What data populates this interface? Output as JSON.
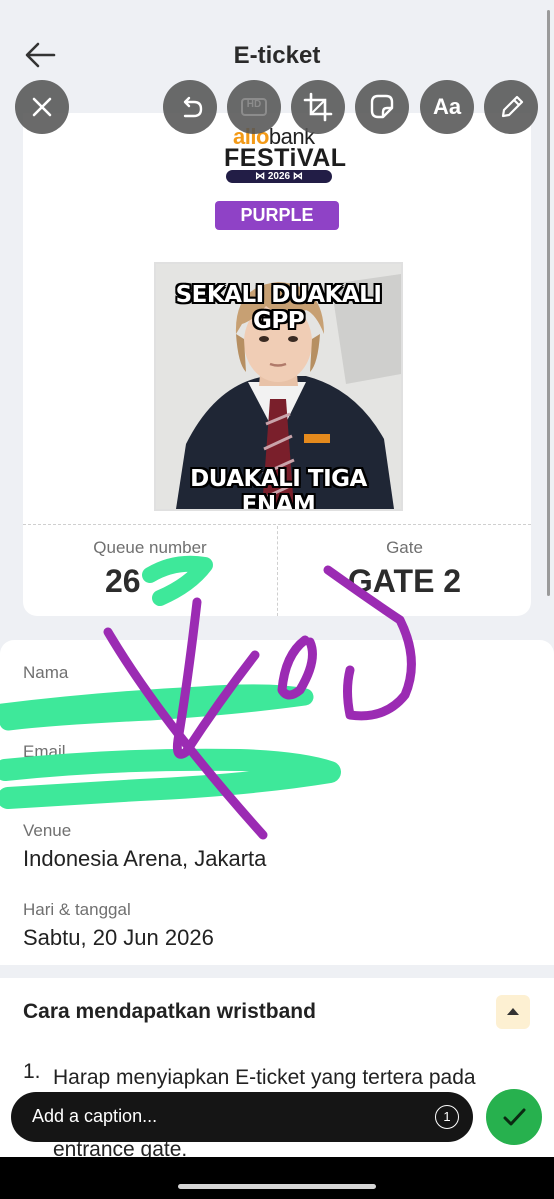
{
  "header": {
    "title": "E-ticket"
  },
  "ticket": {
    "logo_word1": "allo",
    "logo_word2": "bank",
    "logo_festival": "FESTiVAL",
    "logo_year": "⋈ 2026 ⋈",
    "tier_badge": "PURPLE",
    "meme_top_text": "SEKALI DUAKALI GPP",
    "meme_bottom_text": "DUAKALI TIGA ENAM",
    "queue_label": "Queue number",
    "queue_value": "26",
    "gate_label": "Gate",
    "gate_value": "GATE 2"
  },
  "info": {
    "nama_label": "Nama",
    "email_label": "Email",
    "venue_label": "Venue",
    "venue_value": "Indonesia Arena, Jakarta",
    "date_label": "Hari & tanggal",
    "date_value": "Sabtu, 20 Jun 2026"
  },
  "wristband": {
    "title": "Cara mendapatkan wristband",
    "step_number": "1.",
    "step_text": "Harap menyiapkan E-ticket yang tertera pada aplikasi ketika akan memasuki antrean di entrance gate."
  },
  "editor": {
    "tools": [
      "close-icon",
      "undo-icon",
      "hd-icon",
      "crop-icon",
      "sticker-icon",
      "text-tool",
      "pen-icon"
    ],
    "hd_label": "HD",
    "text_tool_label": "Aa",
    "caption_placeholder": "Add a caption...",
    "view_once_label": "1",
    "drawing_color": "#9b2bb3",
    "redaction_color": "#3ee89a"
  }
}
